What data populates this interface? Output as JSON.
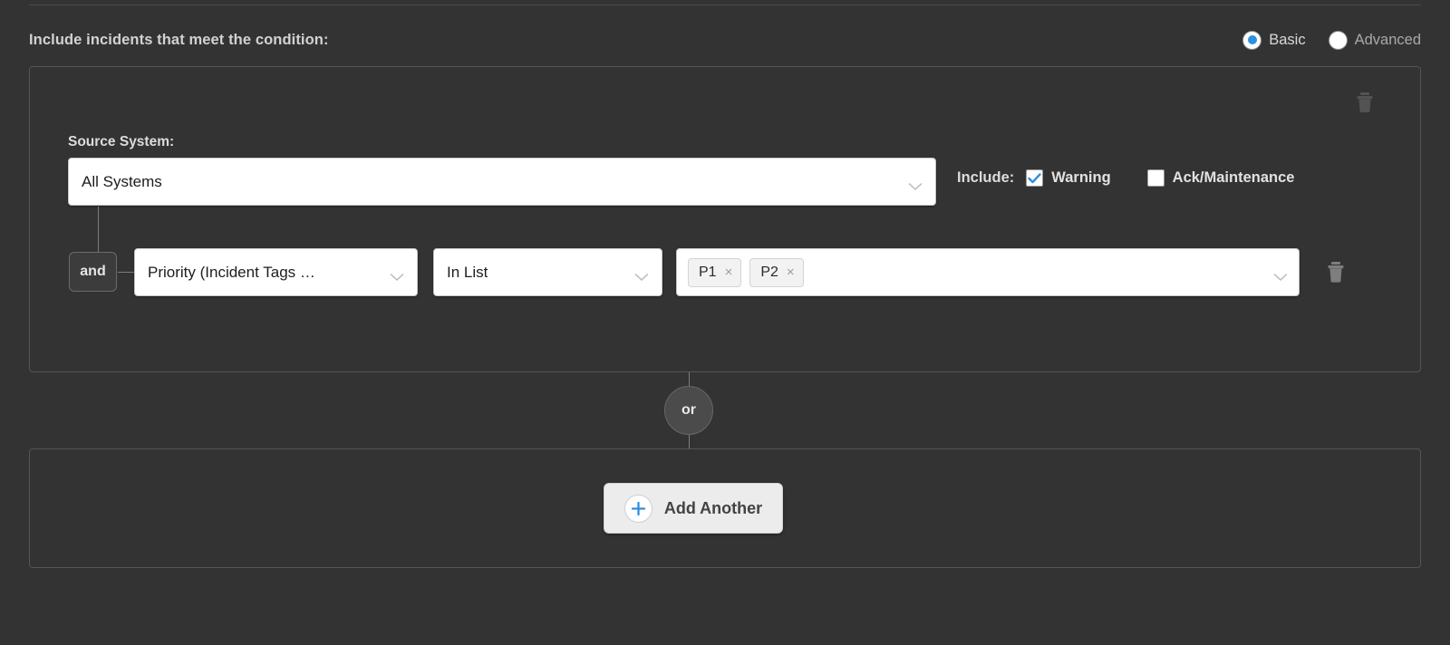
{
  "header": {
    "title": "Include incidents that meet the condition:",
    "modes": [
      {
        "label": "Basic",
        "selected": true
      },
      {
        "label": "Advanced",
        "selected": false
      }
    ],
    "accent_color": "#2d8fe0"
  },
  "group1": {
    "source_system": {
      "label": "Source System:",
      "value": "All Systems"
    },
    "include": {
      "label": "Include:",
      "options": [
        {
          "label": "Warning",
          "checked": true
        },
        {
          "label": "Ack/Maintenance",
          "checked": false
        }
      ]
    },
    "condition_row": {
      "connector": "and",
      "field": "Priority (Incident Tags …",
      "operator": "In List",
      "tags": [
        {
          "label": "P1",
          "remove": "×"
        },
        {
          "label": "P2",
          "remove": "×"
        }
      ],
      "delete_icon": "trash-icon"
    },
    "delete_icon": "trash-icon"
  },
  "or_connector": {
    "label": "or"
  },
  "group2": {
    "add_another": {
      "label": "Add Another",
      "icon": "plus-icon"
    }
  },
  "colors": {
    "background": "#333333",
    "panel_border": "#555555",
    "field_background": "#ffffff",
    "accent_blue": "#2d8fe0",
    "text_light": "#d8d8d8"
  }
}
